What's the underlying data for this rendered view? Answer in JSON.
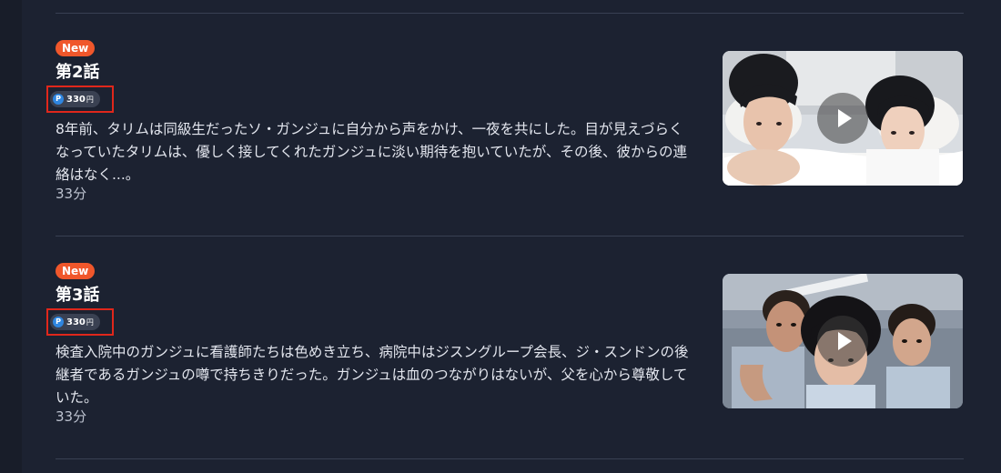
{
  "episodes": [
    {
      "badge": "New",
      "title": "第2話",
      "price_icon": "P",
      "price": "330",
      "price_unit": "円",
      "synopsis": "8年前、タリムは同級生だったソ・ガンジュに自分から声をかけ、一夜を共にした。目が見えづらくなっていたタリムは、優しく接してくれたガンジュに淡い期待を抱いていたが、その後、彼からの連絡はなく...。",
      "duration": "33分",
      "thumbnail": "couple-in-bed-scene",
      "play_icon": "play-icon"
    },
    {
      "badge": "New",
      "title": "第3話",
      "price_icon": "P",
      "price": "330",
      "price_unit": "円",
      "synopsis": "検査入院中のガンジュに看護師たちは色めき立ち、病院中はジスングループ会長、ジ・スンドンの後継者であるガンジュの噂で持ちきりだった。ガンジュは血のつながりはないが、父を心から尊敬していた。",
      "duration": "33分",
      "thumbnail": "three-people-closeup-scene",
      "play_icon": "play-icon"
    }
  ],
  "colors": {
    "background": "#1c2231",
    "badge": "#f0572b",
    "highlight_border": "#e0271b",
    "point_icon": "#2f86e0"
  }
}
